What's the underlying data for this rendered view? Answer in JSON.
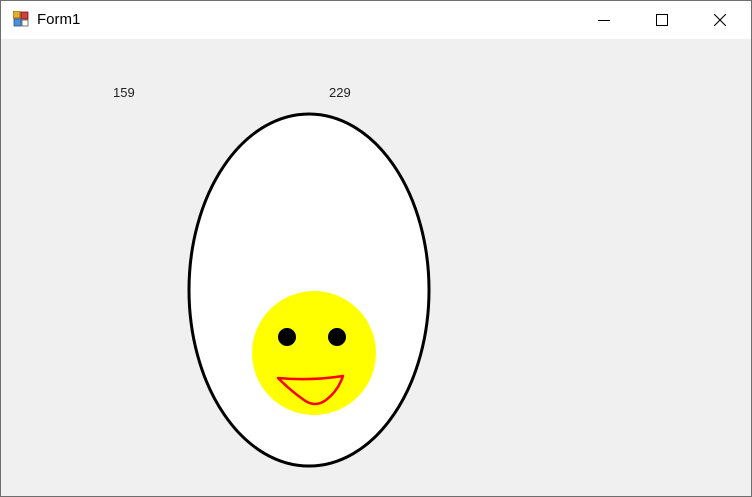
{
  "window": {
    "title": "Form1",
    "minimize_icon": "minimize-icon",
    "maximize_icon": "maximize-icon",
    "close_icon": "close-icon"
  },
  "labels": {
    "label1": "159",
    "label2": "229"
  },
  "drawing": {
    "egg_fill": "#ffffff",
    "egg_stroke": "#000000",
    "face_fill": "#ffff00",
    "eye_fill": "#000000",
    "mouth_stroke": "#ff0000"
  }
}
